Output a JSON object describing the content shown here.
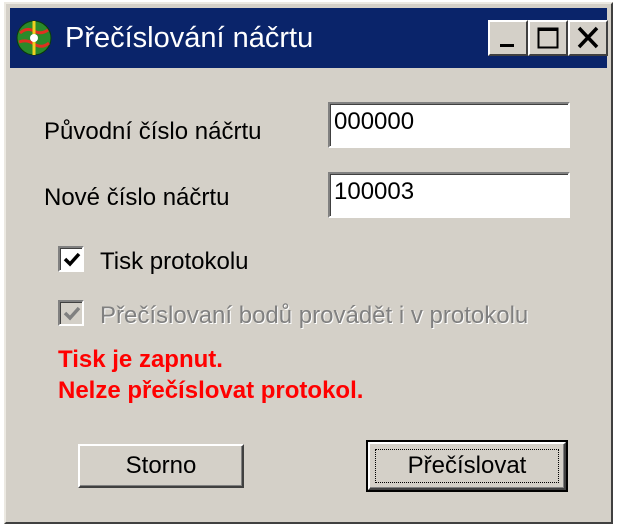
{
  "window": {
    "title": "Přečíslování náčrtu",
    "icon": "app-globe-icon",
    "controls": {
      "minimize_icon": "minimize-icon",
      "maximize_icon": "maximize-icon",
      "close_icon": "close-icon"
    }
  },
  "form": {
    "original_label": "Původní číslo náčrtu",
    "original_value": "000000",
    "new_label": "Nové číslo náčrtu",
    "new_value": "100003",
    "print_protocol_label": "Tisk protokolu",
    "print_protocol_checked": true,
    "renumber_in_protocol_label": "Přečíslovaní bodů provádět i v protokolu",
    "renumber_in_protocol_checked": true,
    "renumber_in_protocol_enabled": false
  },
  "warning": {
    "line1": "Tisk je zapnut.",
    "line2": "Nelze přečíslovat protokol.",
    "color": "#ff0000"
  },
  "buttons": {
    "cancel_label": "Storno",
    "renumber_label": "Přečíslovat"
  },
  "colors": {
    "titlebar": "#0a246a",
    "face": "#d4d0c8"
  }
}
